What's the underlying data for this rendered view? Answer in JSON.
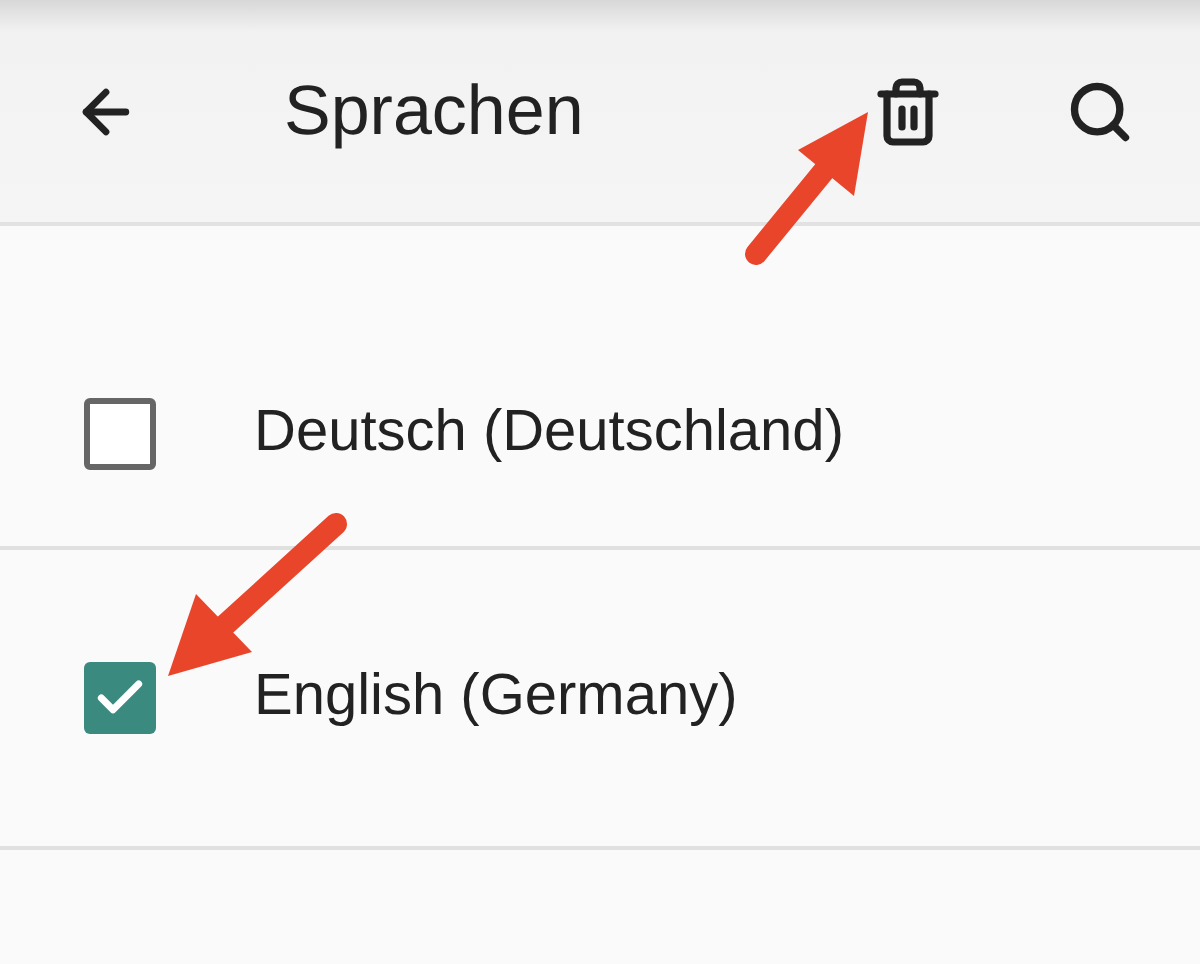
{
  "app_bar": {
    "title": "Sprachen"
  },
  "languages": [
    {
      "label": "Deutsch (Deutschland)",
      "checked": false
    },
    {
      "label": "English (Germany)",
      "checked": true
    }
  ]
}
